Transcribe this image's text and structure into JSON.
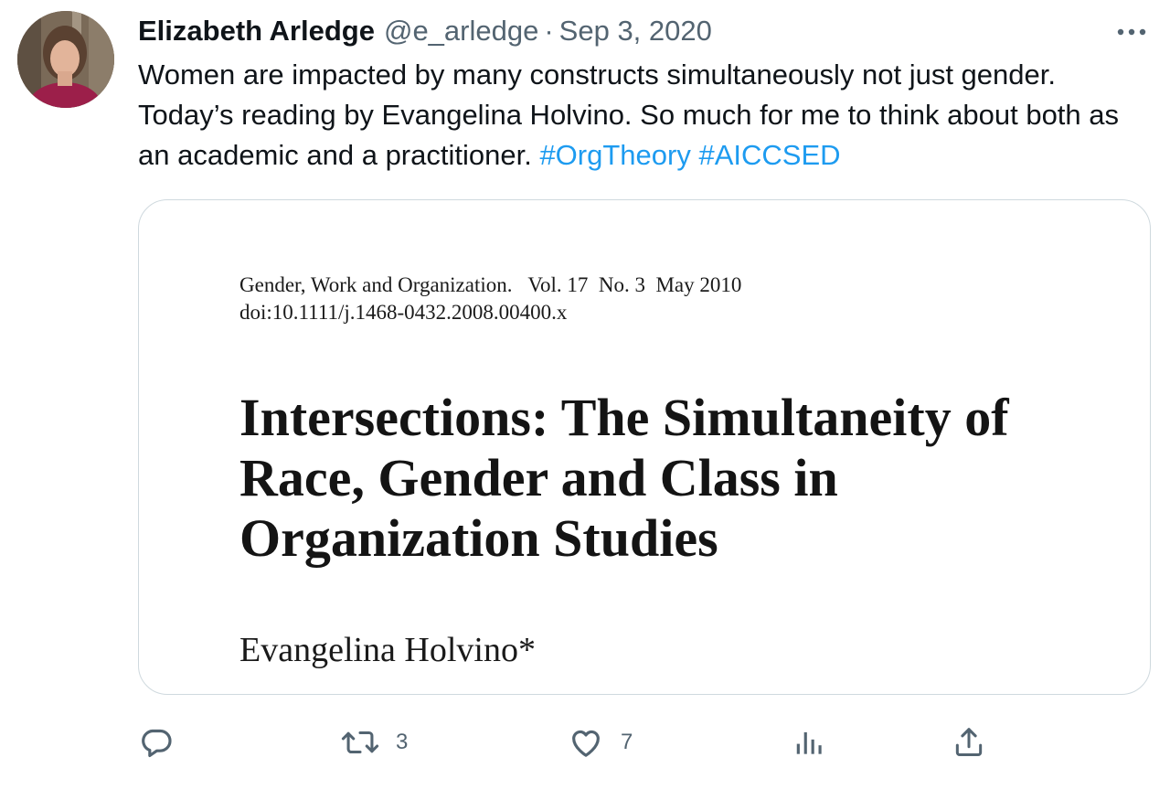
{
  "tweet": {
    "author": {
      "display_name": "Elizabeth Arledge",
      "handle": "@e_arledge",
      "separator": "·",
      "date": "Sep 3, 2020",
      "avatar_icon": "profile-photo"
    },
    "text": {
      "body": "Women are impacted by many constructs simultaneously not just gender. Today’s reading by Evangelina Holvino. So much for me to think about both as an academic and a practitioner. ",
      "hashtags": [
        "#OrgTheory",
        "#AICCSED"
      ]
    },
    "more_icon": "more-dots-icon",
    "media": {
      "journal_line": "Gender, Work and Organization.   Vol. 17  No. 3  May 2010",
      "doi": "doi:10.1111/j.1468-0432.2008.00400.x",
      "title": "Intersections: The Simultaneity of Race, Gender and Class in Organization Studies",
      "author": "Evangelina Holvino*"
    },
    "actions": {
      "reply": {
        "icon": "reply-icon",
        "count": ""
      },
      "retweet": {
        "icon": "retweet-icon",
        "count": "3"
      },
      "like": {
        "icon": "heart-icon",
        "count": "7"
      },
      "views": {
        "icon": "analytics-icon",
        "count": ""
      },
      "share": {
        "icon": "share-icon",
        "count": ""
      }
    }
  },
  "colors": {
    "text_primary": "#0f1419",
    "text_secondary": "#536471",
    "hashtag": "#1d9bf0",
    "card_border": "#cfd9de"
  }
}
